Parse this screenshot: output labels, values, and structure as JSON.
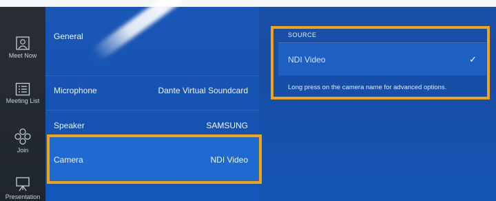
{
  "sidebar": {
    "items": [
      {
        "label": "Meet Now",
        "icon": "person-icon"
      },
      {
        "label": "Meeting List",
        "icon": "list-icon"
      },
      {
        "label": "Join",
        "icon": "join-icon"
      },
      {
        "label": "Presentation",
        "icon": "presentation-icon"
      }
    ]
  },
  "settings": {
    "rows": [
      {
        "name": "General",
        "value": ""
      },
      {
        "name": "Microphone",
        "value": "Dante Virtual Soundcard"
      },
      {
        "name": "Speaker",
        "value": "SAMSUNG"
      },
      {
        "name": "Camera",
        "value": "NDI Video"
      }
    ]
  },
  "source": {
    "title": "SOURCE",
    "selected": "NDI Video",
    "check": "✓",
    "note": "Long press on the camera name for advanced options."
  },
  "colors": {
    "highlight": "#f5a40b",
    "background": "#1a56b5",
    "sidebar": "#2a2f36"
  }
}
